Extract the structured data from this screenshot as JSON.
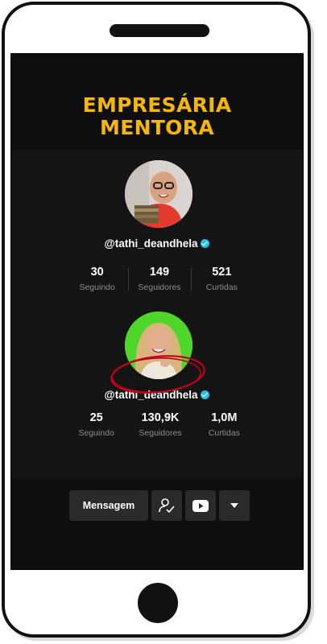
{
  "headline": {
    "line1": "EMPRESÁRIA",
    "line2": "MENTORA"
  },
  "profile_before": {
    "handle": "@tathi_deandhela",
    "verified": true,
    "stats": [
      {
        "value": "30",
        "label": "Seguindo"
      },
      {
        "value": "149",
        "label": "Seguidores"
      },
      {
        "value": "521",
        "label": "Curtidas"
      }
    ]
  },
  "profile_after": {
    "handle": "@tathi_deandhela",
    "verified": true,
    "stats": [
      {
        "value": "25",
        "label": "Seguindo"
      },
      {
        "value": "130,9K",
        "label": "Seguidores"
      },
      {
        "value": "1,0M",
        "label": "Curtidas"
      }
    ],
    "actions": {
      "message_label": "Mensagem",
      "icons": [
        "follow-user-icon",
        "youtube-icon",
        "dropdown-arrow-icon"
      ]
    }
  },
  "colors": {
    "headline": "#f5b700",
    "screen_bg": "#0e0e0e",
    "verified_badge": "#20c2e8",
    "highlight_circle": "#c0001a",
    "avatar2_bg": "#4fd62a"
  }
}
